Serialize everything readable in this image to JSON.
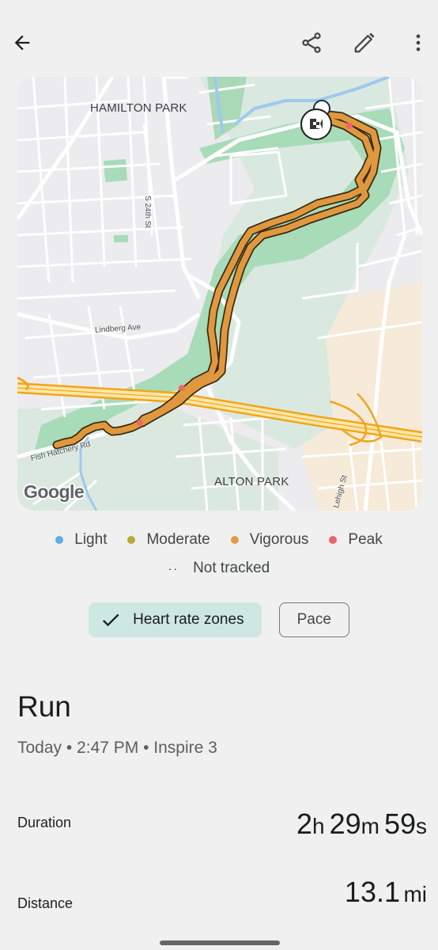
{
  "header": {
    "back_icon": "arrow-left-icon",
    "share_icon": "share-icon",
    "edit_icon": "pencil-icon",
    "more_icon": "more-vert-icon"
  },
  "map": {
    "labels": {
      "hamilton_park": "HAMILTON PARK",
      "alton_park": "ALTON PARK",
      "s24th": "S 24th St",
      "lindberg": "Lindberg Ave",
      "fish_hatchery": "Fish Hatchery Rd",
      "lehigh": "Lehigh St"
    },
    "attribution": "Google",
    "marker_icon": "checkered-flag-icon",
    "route_color": "#e0983f",
    "peak_color": "#ef6868"
  },
  "legend": {
    "items": [
      {
        "label": "Light",
        "color": "#5caee6"
      },
      {
        "label": "Moderate",
        "color": "#b8a83a"
      },
      {
        "label": "Vigorous",
        "color": "#e29a45"
      },
      {
        "label": "Peak",
        "color": "#ef6168"
      }
    ],
    "not_tracked": "Not tracked",
    "not_tracked_symbol": "··"
  },
  "chips": {
    "heart_rate": "Heart rate zones",
    "pace": "Pace"
  },
  "activity": {
    "title": "Run",
    "subtitle": "Today • 2:47 PM • Inspire 3"
  },
  "stats": {
    "duration": {
      "label": "Duration",
      "hours": "2",
      "hours_unit": "h",
      "minutes": "29",
      "minutes_unit": "m",
      "seconds": "59",
      "seconds_unit": "s"
    },
    "distance": {
      "label": "Distance",
      "value": "13.1",
      "unit": "mi"
    }
  }
}
